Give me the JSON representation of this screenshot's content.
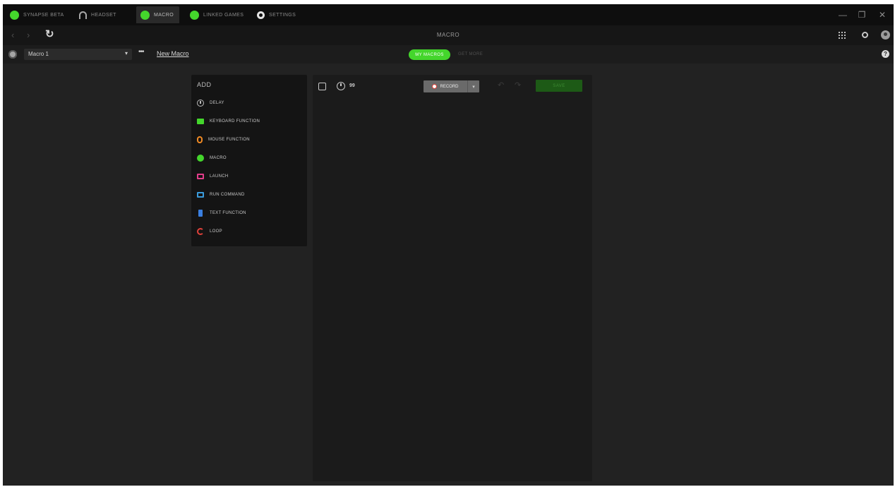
{
  "topbar": {
    "tabs": [
      {
        "label": "SYNAPSE BETA",
        "icon": "razer-logo-icon"
      },
      {
        "label": "HEADSET",
        "icon": "headset-icon"
      },
      {
        "label": "MACRO",
        "icon": "macro-icon",
        "active": true
      },
      {
        "label": "LINKED GAMES",
        "icon": "linked-games-icon"
      },
      {
        "label": "SETTINGS",
        "icon": "gear-icon"
      }
    ],
    "window_controls": {
      "minimize": "—",
      "maximize": "❐",
      "close": "✕"
    }
  },
  "navbar": {
    "back": "‹",
    "forward": "›",
    "refresh": "↻",
    "title": "MACRO"
  },
  "subbar": {
    "selected_macro": "Macro 1",
    "more": "•••",
    "new_macro_link": "New Macro",
    "segments": {
      "my_macros": "MY MACROS",
      "other": "GET MORE"
    },
    "help": "?"
  },
  "add_panel": {
    "title": "ADD",
    "items": [
      {
        "label": "DELAY",
        "icon": "clock-icon"
      },
      {
        "label": "KEYBOARD FUNCTION",
        "icon": "keyboard-icon"
      },
      {
        "label": "MOUSE FUNCTION",
        "icon": "mouse-icon"
      },
      {
        "label": "MACRO",
        "icon": "macro-icon"
      },
      {
        "label": "LAUNCH",
        "icon": "launch-icon"
      },
      {
        "label": "RUN COMMAND",
        "icon": "run-command-icon"
      },
      {
        "label": "TEXT FUNCTION",
        "icon": "text-function-icon"
      },
      {
        "label": "LOOP",
        "icon": "loop-icon"
      }
    ]
  },
  "editor": {
    "delay_value": "99",
    "record_label": "RECORD",
    "record_dropdown": "▾",
    "undo": "↶",
    "redo": "↷",
    "save_label": "SAVE"
  },
  "colors": {
    "accent": "#44d62c",
    "background": "#222222",
    "panel": "#141414",
    "editor": "#1b1b1b"
  }
}
